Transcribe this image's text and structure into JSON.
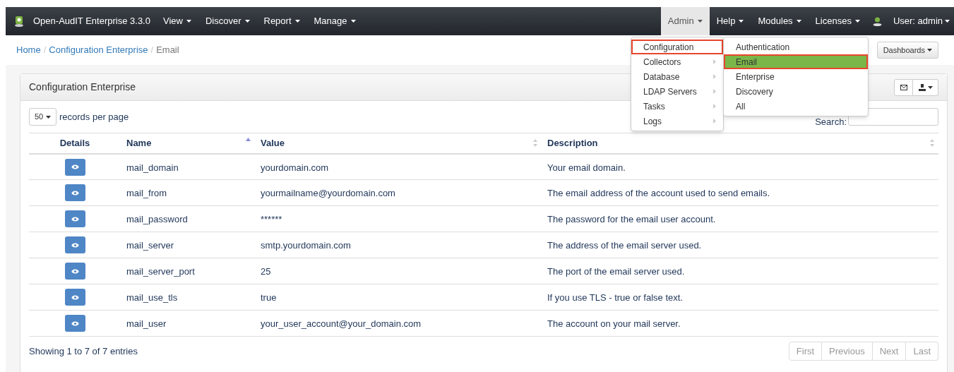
{
  "navbar": {
    "brand": "Open-AudIT Enterprise 3.3.0",
    "left_menus": [
      {
        "label": "View",
        "open": false
      },
      {
        "label": "Discover",
        "open": false
      },
      {
        "label": "Report",
        "open": false
      },
      {
        "label": "Manage",
        "open": false
      }
    ],
    "right_menus": [
      {
        "label": "Admin",
        "open": true
      },
      {
        "label": "Help",
        "open": false
      },
      {
        "label": "Modules",
        "open": false
      },
      {
        "label": "Licenses",
        "open": false
      }
    ],
    "user": "User: admin"
  },
  "breadcrumb": [
    {
      "label": "Home",
      "link": true
    },
    {
      "separator": "/",
      "label": "Configuration Enterprise",
      "link": true
    },
    {
      "separator": "/",
      "label": "Email",
      "link": false
    }
  ],
  "dashboards_button": "Dashboards",
  "panel": {
    "title": "Configuration Enterprise",
    "page_size": "50",
    "page_size_label": "records per page",
    "search_label": "Search:",
    "columns": [
      {
        "label": "Details",
        "sortable": false
      },
      {
        "label": "Name",
        "sortable": true,
        "sorted": true
      },
      {
        "label": "Value",
        "sortable": true,
        "sorted": false
      },
      {
        "label": "Description",
        "sortable": true,
        "sorted": false
      }
    ],
    "rows": [
      {
        "name": "mail_domain",
        "value": "yourdomain.com",
        "description": "Your email domain."
      },
      {
        "name": "mail_from",
        "value": "yourmailname@yourdomain.com",
        "description": "The email address of the account used to send emails."
      },
      {
        "name": "mail_password",
        "value": "******",
        "description": "The password for the email user account."
      },
      {
        "name": "mail_server",
        "value": "smtp.yourdomain.com",
        "description": "The address of the email server used."
      },
      {
        "name": "mail_server_port",
        "value": "25",
        "description": "The port of the email server used."
      },
      {
        "name": "mail_use_tls",
        "value": "true",
        "description": "If you use TLS - true or false text."
      },
      {
        "name": "mail_user",
        "value": "your_user_account@your_domain.com",
        "description": "The account on your mail server."
      }
    ],
    "info": "Showing 1 to 7 of 7 entries",
    "pagination": [
      "First",
      "Previous",
      "Next",
      "Last"
    ]
  },
  "admin_menu": {
    "items": [
      {
        "label": "Configuration",
        "selected": true,
        "submenu": false
      },
      {
        "label": "Collectors",
        "selected": false,
        "submenu": true
      },
      {
        "label": "Database",
        "selected": false,
        "submenu": true
      },
      {
        "label": "LDAP Servers",
        "selected": false,
        "submenu": true
      },
      {
        "label": "Tasks",
        "selected": false,
        "submenu": true
      },
      {
        "label": "Logs",
        "selected": false,
        "submenu": true
      }
    ],
    "submenu": [
      {
        "label": "Authentication",
        "selected": false
      },
      {
        "label": "Email",
        "selected": true
      },
      {
        "label": "Enterprise",
        "selected": false
      },
      {
        "label": "Discovery",
        "selected": false
      },
      {
        "label": "All",
        "selected": false
      }
    ]
  }
}
